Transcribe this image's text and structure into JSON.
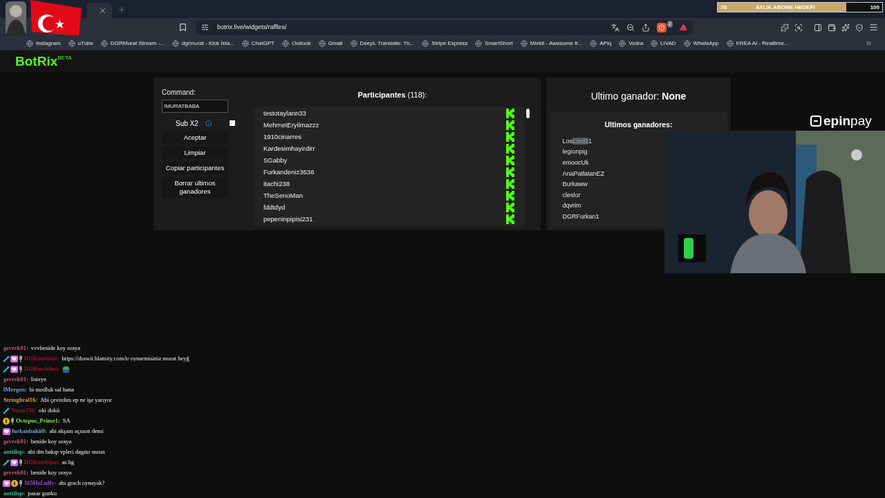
{
  "goal_widget": {
    "current": "78",
    "label": "AYLIK ABONE HEDEFI",
    "target": "100",
    "level": 0.78
  },
  "browser": {
    "url": "botrix.live/widgets/raffles/",
    "shield_badge": "2",
    "bookmarks": [
      "Instagram",
      "uTube",
      "DGRMurat Stream -...",
      "dgrmurat - Kick İsta...",
      "ChatGPT",
      "Outlook",
      "Gmail",
      "DeepL Translate: Th...",
      "Stripe Express",
      "SmartShort",
      "Mixkit - Awesome fr...",
      "APiq",
      "Vodra",
      "LIVAD",
      "WhatsApp",
      "KREA AI - Realtime..."
    ]
  },
  "app": {
    "logo": "BotRix",
    "logo_tag": "BETA"
  },
  "controls": {
    "command_label": "Command:",
    "command_value": "!MURATBABA",
    "sub_label": "Sub X2",
    "sub_checked": false,
    "buttons": [
      "Aceptar",
      "Limpiar",
      "Copiar participantes",
      "Borrar ultimos ganadores"
    ]
  },
  "participants": {
    "title": "**Participantes** (118):",
    "items": [
      "testotaylann33",
      "MehmetEryilmazzz",
      "1910cinarres",
      "Kardesimhayirdirr",
      "SGabby",
      "Furkandeniz3636",
      "itachi238",
      "TheSenoMan",
      "fddtdyd",
      "pepeninpipisi231"
    ]
  },
  "winner": {
    "text": "Ultimo ganador: **None**",
    "list_title": "Ultimos ganadores:",
    "items": [
      {
        "pre": "Los",
        "selected_part": "Lord2",
        "post": "1"
      },
      {
        "pre": "legionpig"
      },
      {
        "pre": "emoocUk"
      },
      {
        "pre": "AnaPatlatanEZ"
      },
      {
        "pre": "Burkaww"
      },
      {
        "pre": "cleslor"
      },
      {
        "pre": "dqvrim"
      },
      {
        "pre": "DGRFurkan1"
      }
    ]
  },
  "sponsor": {
    "brand": "epin",
    "brand_light": "pay"
  },
  "chat": [
    {
      "user": "gevrek01:",
      "color": "#c0587a",
      "text": "vvvbenide koy oraya"
    },
    {
      "user": "DGRmvlshot:",
      "color": "#a3102e",
      "badges": [
        {
          "kind": "sword"
        },
        {
          "kind": "heart"
        },
        {
          "kind": "mic"
        }
      ],
      "text": "https://drawit.blamity.com/tr oynarmisiniz murat beyğ"
    },
    {
      "user": "DGRmvlshot:",
      "color": "#a3102e",
      "badges": [
        {
          "kind": "sword"
        },
        {
          "kind": "heart"
        },
        {
          "kind": "mic"
        }
      ],
      "emote": true
    },
    {
      "user": "gevrek01:",
      "color": "#c0587a",
      "text": "listeye"
    },
    {
      "user": "lMergen:",
      "color": "#6d9fd6",
      "text": "bi modluk sal bana"
    },
    {
      "user": "Stringhral16:",
      "color": "#e09a3a",
      "text": "Abi çevirdim ep ne işe yarıyor"
    },
    {
      "user": "NormTR:",
      "color": "#a3102e",
      "badges": [
        {
          "kind": "sword"
        }
      ],
      "text": "oki dokii"
    },
    {
      "user": "Octopus_Prime1:",
      "color": "#7ee04a",
      "badges": [
        {
          "kind": "coin"
        },
        {
          "kind": "mic"
        }
      ],
      "text": "SA"
    },
    {
      "user": "furkanbakii0:",
      "color": "#7f9cc9",
      "badges": [
        {
          "kind": "heart"
        }
      ],
      "text": "abi akşam açıuon demi"
    },
    {
      "user": "gevrek01:",
      "color": "#c0587a",
      "text": "benide koy oraya"
    },
    {
      "user": "anttilop:",
      "color": "#2fbf8a",
      "text": "abi dm bakıp vpleri dagıtır mısın"
    },
    {
      "user": "DGRmvlshot:",
      "color": "#a3102e",
      "badges": [
        {
          "kind": "sword"
        },
        {
          "kind": "heart"
        },
        {
          "kind": "mic"
        }
      ],
      "text": "as hg"
    },
    {
      "user": "gevrek01:",
      "color": "#c0587a",
      "text": "benide koy oraya"
    },
    {
      "user": "165HzLuffy:",
      "color": "#9b4de0",
      "badges": [
        {
          "kind": "heart"
        },
        {
          "kind": "coin"
        },
        {
          "kind": "mic"
        }
      ],
      "text": "abi grach oynayak?"
    },
    {
      "user": "anttilop:",
      "color": "#2fbf8a",
      "text": "pazar gunku"
    }
  ]
}
